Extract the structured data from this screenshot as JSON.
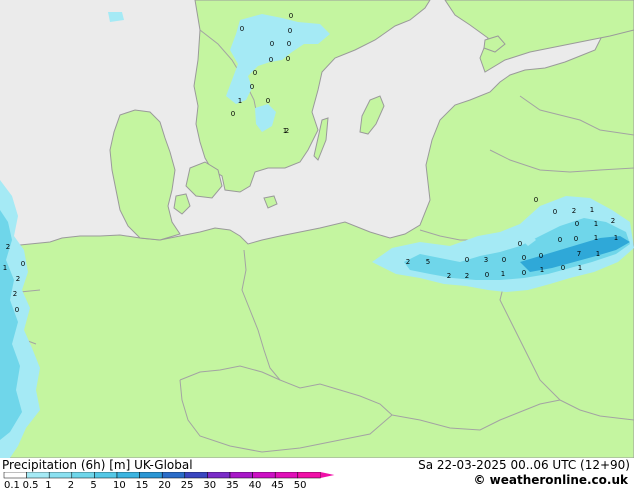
{
  "map": {
    "colors": {
      "sea": "#ebebeb",
      "land": "#c4f5a0",
      "border": "#a3a3a3",
      "coast": "#9a9a9a",
      "precip_light": "#a5eaf5",
      "precip_mid": "#6fd6ea",
      "precip_strong": "#2fa8d8"
    },
    "value_labels": [
      {
        "v": "0"
      },
      {
        "v": "0"
      },
      {
        "v": "0"
      },
      {
        "v": "0"
      },
      {
        "v": "0"
      },
      {
        "v": "0"
      },
      {
        "v": "0"
      },
      {
        "v": "0"
      },
      {
        "v": "0"
      },
      {
        "v": "1"
      },
      {
        "v": "0"
      },
      {
        "v": "0"
      },
      {
        "v": "1"
      },
      {
        "v": "2"
      },
      {
        "v": "2"
      },
      {
        "v": "0"
      },
      {
        "v": "2"
      },
      {
        "v": "2"
      },
      {
        "v": "1"
      },
      {
        "v": "0"
      },
      {
        "v": "0"
      },
      {
        "v": "2"
      },
      {
        "v": "1"
      },
      {
        "v": "2"
      },
      {
        "v": "0"
      },
      {
        "v": "1"
      },
      {
        "v": "0"
      },
      {
        "v": "1"
      },
      {
        "v": "0"
      },
      {
        "v": "0"
      },
      {
        "v": "1"
      },
      {
        "v": "2"
      },
      {
        "v": "5"
      },
      {
        "v": "0"
      },
      {
        "v": "3"
      },
      {
        "v": "0"
      },
      {
        "v": "0"
      },
      {
        "v": "0"
      },
      {
        "v": "7"
      },
      {
        "v": "1"
      },
      {
        "v": "2"
      },
      {
        "v": "2"
      },
      {
        "v": "0"
      },
      {
        "v": "1"
      },
      {
        "v": "0"
      },
      {
        "v": "1"
      },
      {
        "v": "0"
      },
      {
        "v": "1"
      },
      {
        "v": "0"
      }
    ]
  },
  "footer": {
    "title": "Precipitation (6h) [m]  UK-Global",
    "datetime": "Sa 22-03-2025 00..06 UTC (12+90)",
    "copyright": "© weatheronline.co.uk",
    "legend": {
      "ticks": [
        "0.1",
        "0.5",
        "1",
        "2",
        "5",
        "10",
        "15",
        "20",
        "25",
        "30",
        "35",
        "40",
        "45",
        "50"
      ],
      "colors": [
        "#fefefe",
        "#a5eaf5",
        "#8ae0f0",
        "#6fd6ea",
        "#55c8e6",
        "#3cb4e0",
        "#2a96d4",
        "#2a6cc8",
        "#3a46c0",
        "#7a2cc8",
        "#a818c8",
        "#cc10c4",
        "#e010b8",
        "#f010a8"
      ]
    }
  }
}
